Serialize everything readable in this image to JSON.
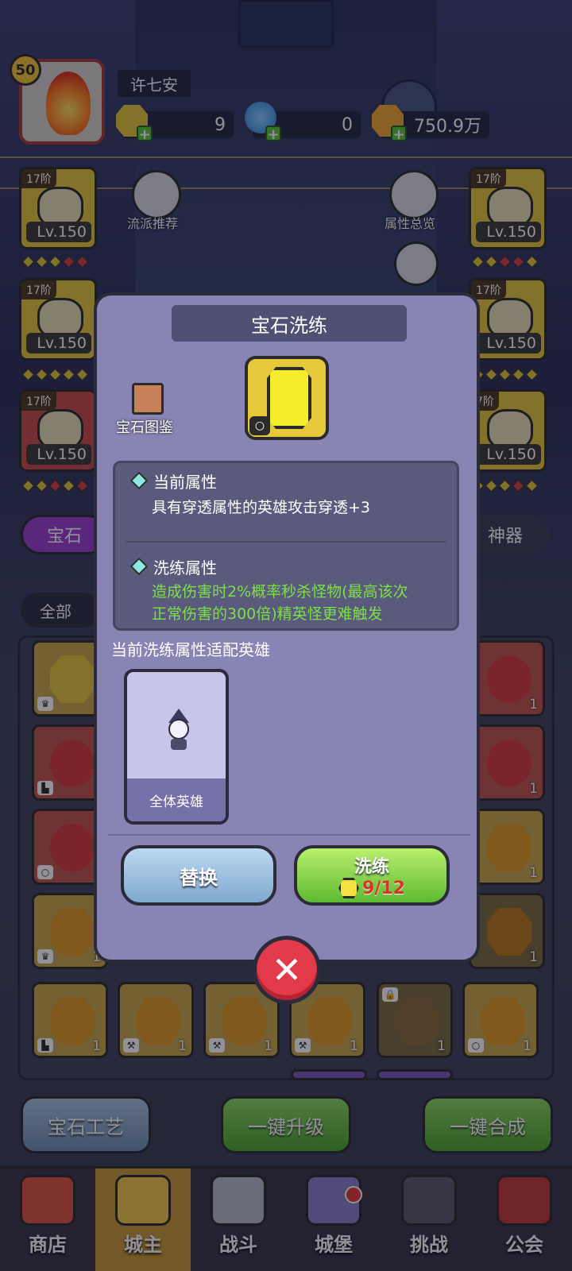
{
  "player": {
    "level": "50",
    "name": "许七安"
  },
  "resources": [
    {
      "icon": "yellow-gem-icon",
      "value": "9"
    },
    {
      "icon": "potion-icon",
      "value": "0"
    },
    {
      "icon": "gold-coin-icon",
      "value": "750.9万"
    }
  ],
  "side_buttons": {
    "left_label": "流派推荐",
    "right_label": "属性总览"
  },
  "equipment": [
    {
      "tier": "17阶",
      "level": "Lv.150"
    },
    {
      "tier": "17阶",
      "level": "Lv.150"
    },
    {
      "tier": "17阶",
      "level": "Lv.150"
    },
    {
      "tier": "17阶",
      "level": "Lv.150"
    },
    {
      "tier": "17阶",
      "level": "Lv.150"
    },
    {
      "tier": "7阶",
      "level": "Lv.150"
    }
  ],
  "tabs": {
    "left": "宝石",
    "right": "神器"
  },
  "filter": "全部",
  "grid": {
    "counts": [
      "1",
      "1",
      "1",
      "1",
      "1",
      "1",
      "1",
      "1",
      "1",
      "1",
      "1",
      "1",
      "1"
    ]
  },
  "bottom_buttons": [
    "宝石工艺",
    "一键升级",
    "一键合成"
  ],
  "nav": [
    "商店",
    "城主",
    "战斗",
    "城堡",
    "挑战",
    "公会"
  ],
  "modal": {
    "title": "宝石洗练",
    "codex_label": "宝石图鉴",
    "current_attr_title": "当前属性",
    "current_attr_text": "具有穿透属性的英雄攻击穿透+3",
    "refine_attr_title": "洗练属性",
    "refine_attr_line1": "造成伤害时2%概率秒杀怪物(最高该次",
    "refine_attr_line2": "正常伤害的300倍)精英怪更难触发",
    "fit_label": "当前洗练属性适配英雄",
    "hero_card_label": "全体英雄",
    "replace_button": "替换",
    "refine_button": "洗练",
    "refine_cost": "9/12"
  }
}
